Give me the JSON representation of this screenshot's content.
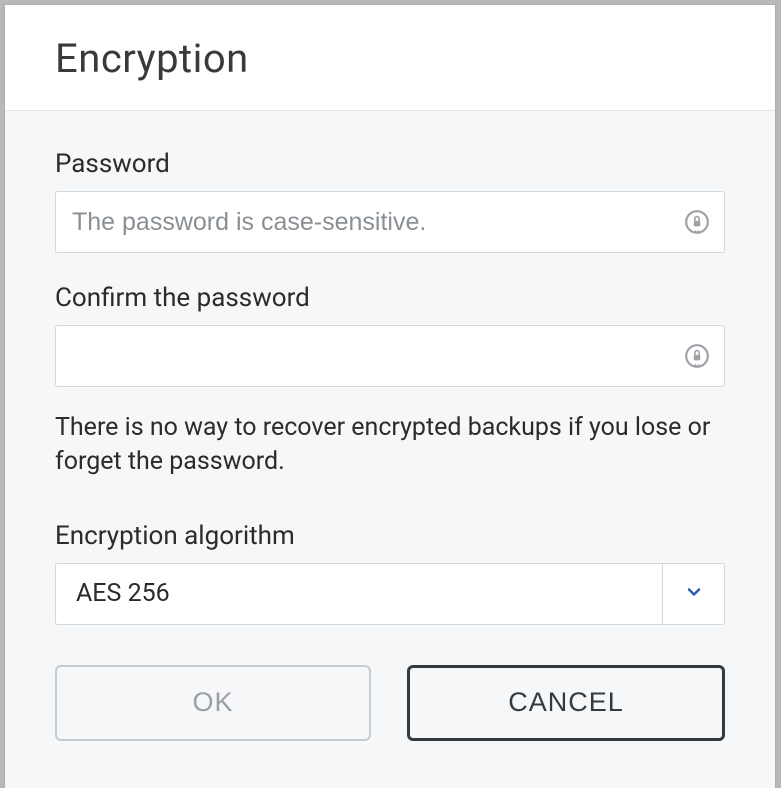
{
  "dialog": {
    "title": "Encryption",
    "password": {
      "label": "Password",
      "placeholder": "The password is case-sensitive.",
      "value": ""
    },
    "confirm": {
      "label": "Confirm the password",
      "placeholder": "",
      "value": ""
    },
    "warning": "There is no way to recover encrypted backups if you lose or forget the password.",
    "algorithm": {
      "label": "Encryption algorithm",
      "selected": "AES 256"
    },
    "buttons": {
      "ok": "OK",
      "cancel": "CANCEL"
    }
  }
}
